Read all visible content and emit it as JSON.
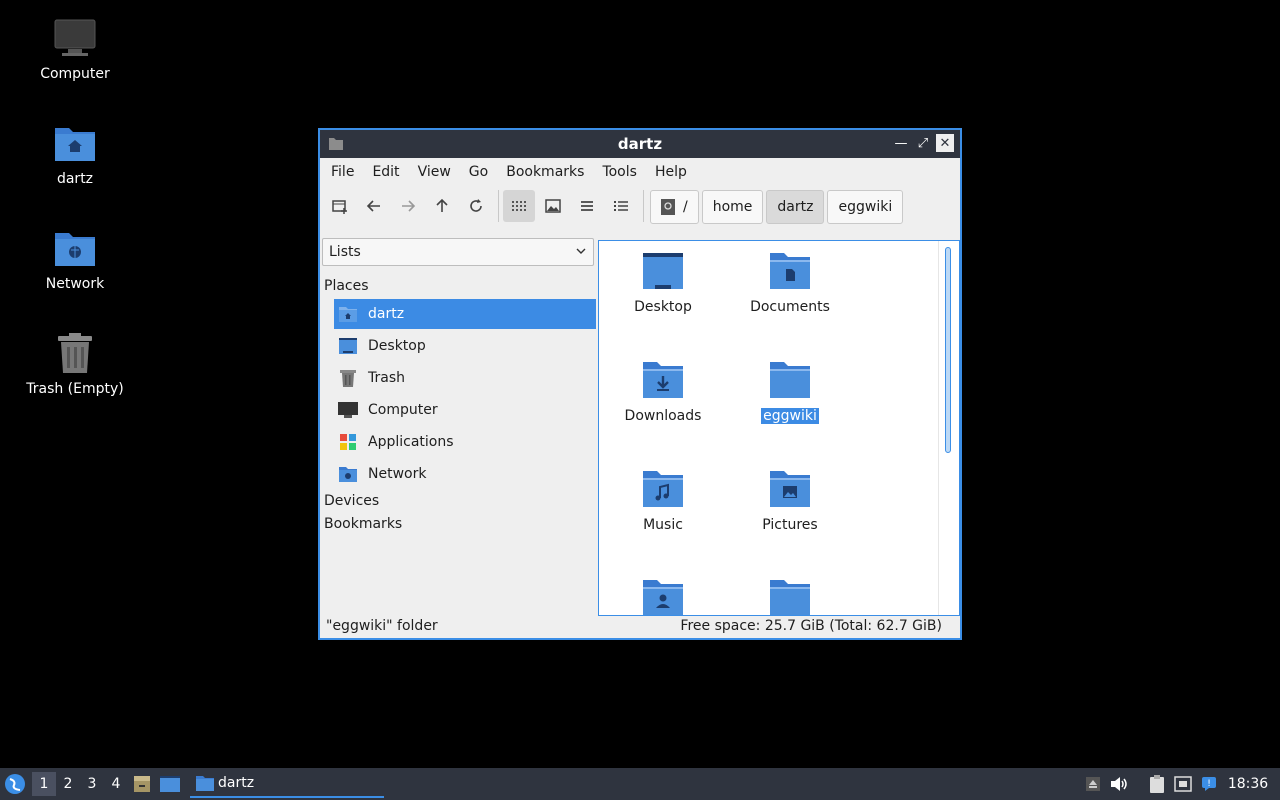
{
  "desktop": {
    "icons": [
      {
        "label": "Computer"
      },
      {
        "label": "dartz"
      },
      {
        "label": "Network"
      },
      {
        "label": "Trash (Empty)"
      }
    ]
  },
  "window": {
    "title": "dartz",
    "menu": [
      "File",
      "Edit",
      "View",
      "Go",
      "Bookmarks",
      "Tools",
      "Help"
    ],
    "breadcrumb": [
      "/",
      "home",
      "dartz",
      "eggwiki"
    ],
    "sidebar": {
      "combo": "Lists",
      "places_header": "Places",
      "places": [
        "dartz",
        "Desktop",
        "Trash",
        "Computer",
        "Applications",
        "Network"
      ],
      "devices_header": "Devices",
      "bookmarks_header": "Bookmarks"
    },
    "files": [
      "Desktop",
      "Documents",
      "Downloads",
      "eggwiki",
      "Music",
      "Pictures"
    ],
    "status": {
      "left": "\"eggwiki\" folder",
      "right": "Free space: 25.7 GiB (Total: 62.7 GiB)"
    }
  },
  "taskbar": {
    "workspaces": [
      "1",
      "2",
      "3",
      "4"
    ],
    "task_label": "dartz",
    "clock": "18:36"
  },
  "colors": {
    "accent": "#3c8be4",
    "folder": "#4a8fdc",
    "panel": "#2f343f"
  }
}
